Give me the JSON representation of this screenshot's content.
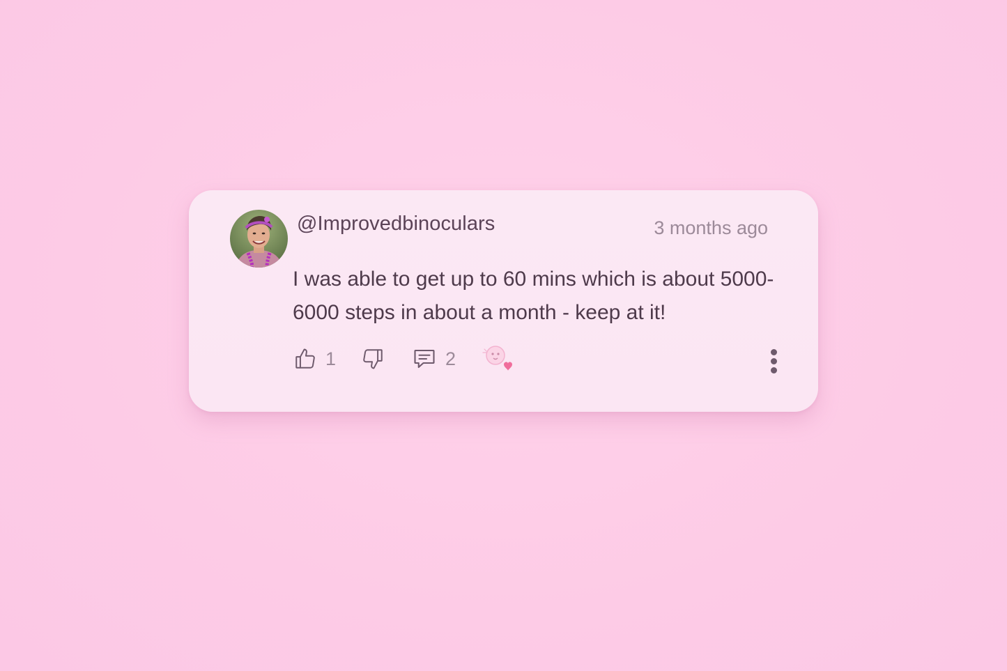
{
  "comment": {
    "username": "@Improvedbinoculars",
    "timestamp": "3 months ago",
    "text": "I was able to get up to 60 mins which is about 5000-6000 steps in about a month - keep at it!",
    "likes": "1",
    "replies": "2"
  },
  "icons": {
    "like": "thumbs-up-icon",
    "dislike": "thumbs-down-icon",
    "reply": "comment-icon",
    "sticker": "heart-sticker-icon",
    "more": "more-vertical-icon"
  },
  "colors": {
    "background": "#fdcbe7",
    "card": "#fbe7f4",
    "text": "#4e3a4b",
    "muted": "#9c8a99",
    "heart": "#f06e9c"
  }
}
